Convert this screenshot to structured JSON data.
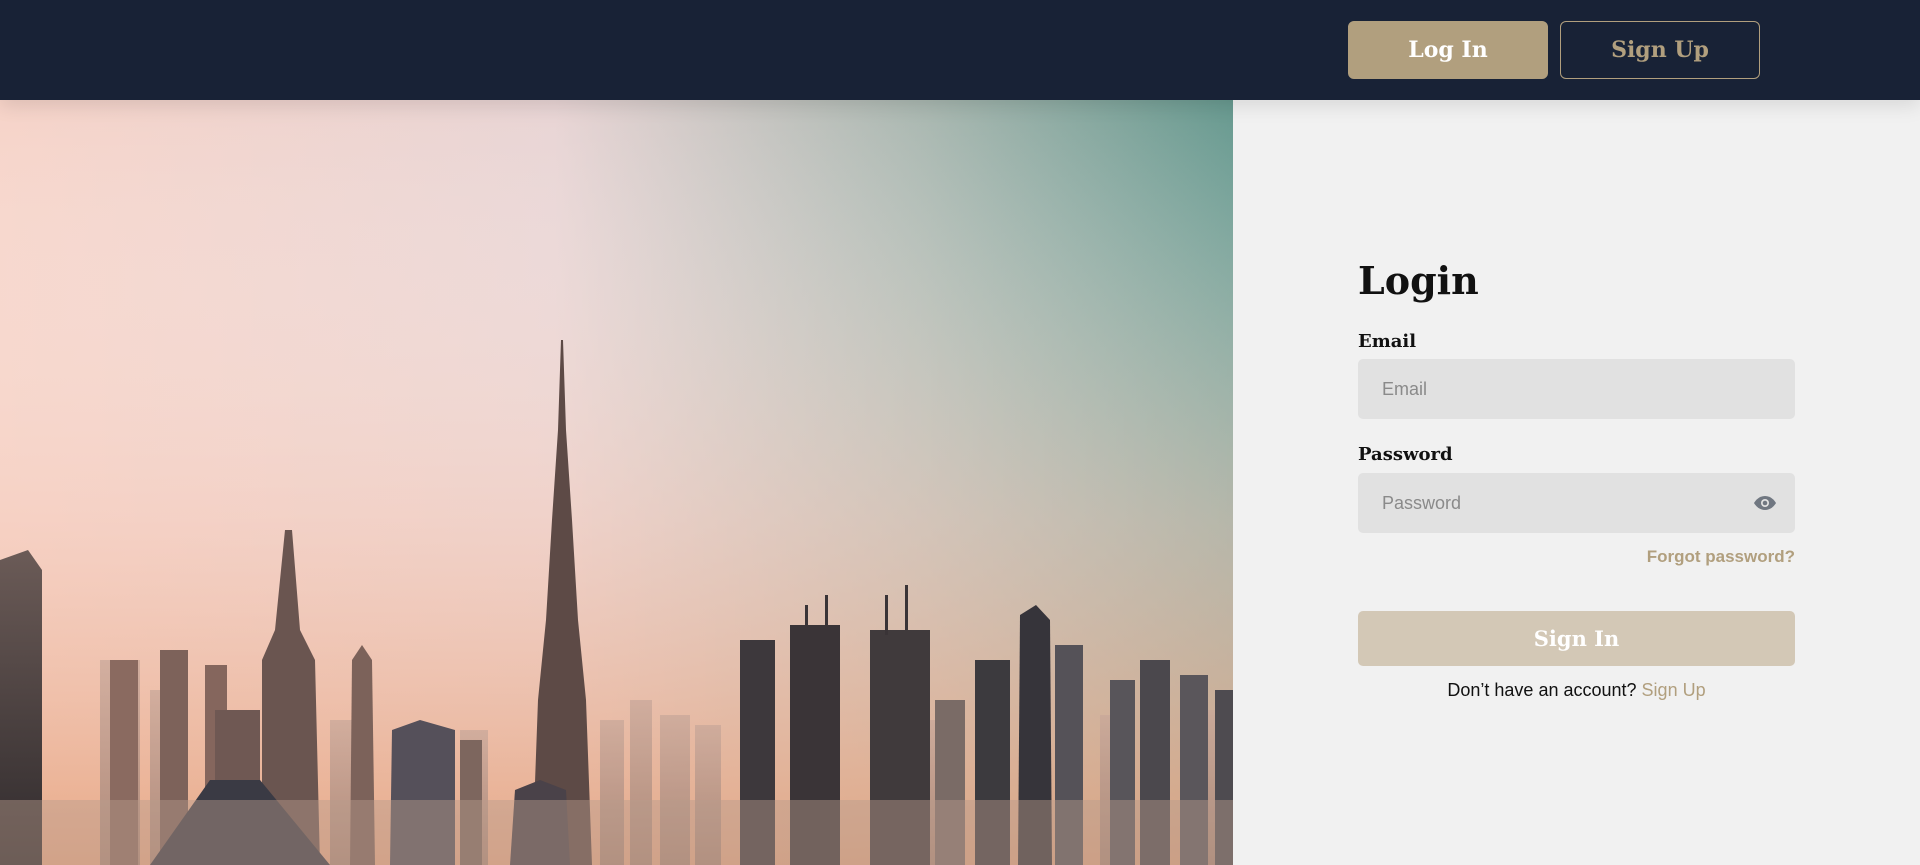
{
  "header": {
    "login_label": "Log In",
    "signup_label": "Sign Up"
  },
  "hero": {
    "image_name": "city-skyline-photo",
    "colors": {
      "sky_top_left": "#f2c8c0",
      "sky_top_right": "#6a9e98",
      "haze": "#f4c9b4"
    }
  },
  "form": {
    "title": "Login",
    "email_label": "Email",
    "email_placeholder": "Email",
    "password_label": "Password",
    "password_placeholder": "Password",
    "password_icon": "eye-icon",
    "forgot_label": "Forgot password?",
    "submit_label": "Sign In",
    "no_account_text": "Don’t have an account?",
    "signup_link": "Sign Up"
  },
  "colors": {
    "header_bg": "#182236",
    "accent": "#b19f7e",
    "panel_bg": "#f1f1f1",
    "input_bg": "#e1e1e1",
    "submit_bg": "#d3c8b6"
  }
}
